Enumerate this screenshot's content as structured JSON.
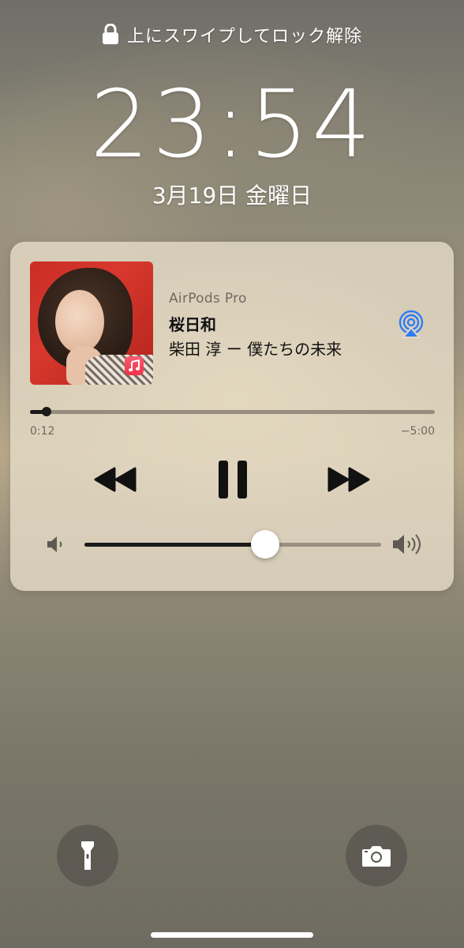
{
  "lockscreen": {
    "unlock_hint": "上にスワイプしてロック解除",
    "time": "23:54",
    "date": "3月19日 金曜日"
  },
  "player": {
    "output_device": "AirPods Pro",
    "title": "桜日和",
    "subtitle": "柴田 淳 ー 僕たちの未来",
    "elapsed": "0:12",
    "remaining": "−5:00",
    "progress_fraction": 0.04,
    "volume_fraction": 0.61,
    "controls": {
      "rewind_icon": "rewind-icon",
      "pause_icon": "pause-icon",
      "fast_forward_icon": "fast-forward-icon"
    },
    "airplay_icon": "airplay-icon",
    "app_badge_icon": "music-note-icon"
  },
  "quick_actions": {
    "left_icon": "flashlight-icon",
    "right_icon": "camera-icon"
  },
  "colors": {
    "airplay_blue": "#2f7cf6",
    "music_badge_red": "#f0324a"
  }
}
